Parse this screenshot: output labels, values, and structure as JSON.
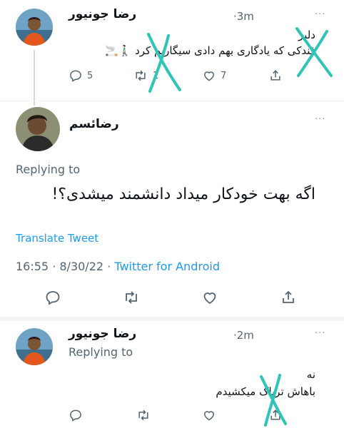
{
  "tweet1": {
    "display_name": "رضا جونیور",
    "time": "·3m",
    "more": "···",
    "line1": "دلبر",
    "line2": "فندکی که یادگاری بهم دادی سیگاریم کرد 🚶🏻‍♂️🚬",
    "replies": "5",
    "retweets": "1",
    "likes": "7"
  },
  "tweet2": {
    "display_name": "رضائسم",
    "more": "···",
    "replying_to": "Replying to",
    "body": "اگه بهت خودکار میداد دانشمند میشدی؟!",
    "translate": "Translate Tweet",
    "timestamp": "16:55 · 8/30/22 · ",
    "source": "Twitter for Android"
  },
  "tweet3": {
    "display_name": "رضا جونیور",
    "time": "·2m",
    "more": "···",
    "replying_to": "Replying to",
    "line1": "نه",
    "line2": "باهاش تریاک میکشیدم"
  },
  "icons": {
    "reply": "reply-icon",
    "retweet": "retweet-icon",
    "like": "heart-icon",
    "share": "share-icon",
    "more": "more-icon"
  },
  "colors": {
    "link": "#1d9bf0",
    "muted": "#536471",
    "marker": "#2ec4b6"
  }
}
